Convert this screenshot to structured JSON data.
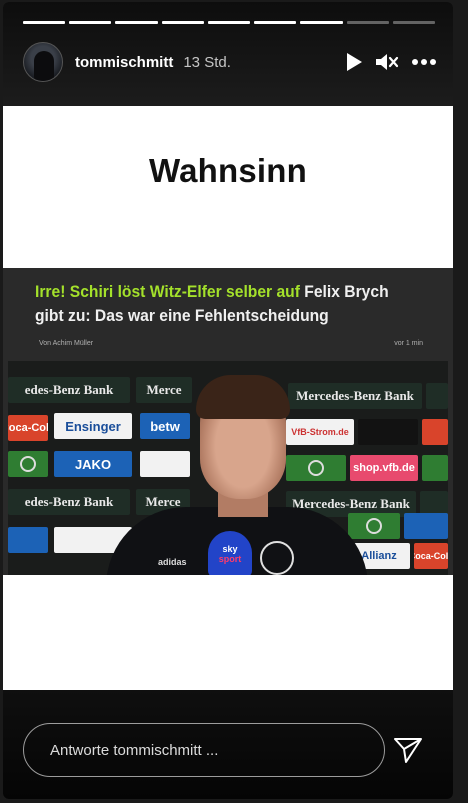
{
  "story": {
    "progress": {
      "total_segments": 9,
      "completed_segments": 7
    },
    "header": {
      "username": "tommischmitt",
      "time_ago": "13 Std.",
      "play_icon": "play-icon",
      "mute_icon": "muted-speaker-icon",
      "more_icon": "more-options-icon"
    },
    "headline": "Wahnsinn",
    "news": {
      "title_highlight": "Irre! Schiri löst Witz-Elfer selber auf",
      "title_rest": "Felix Brych gibt zu: Das war eine Fehlentscheidung",
      "author": "Von Achim Müller",
      "ago": "vor 1 min",
      "boards": {
        "mercedes": "Mercedes-Benz Bank",
        "mercedes_short": "Merce",
        "mercedes_left": "edes-Benz Bank",
        "ensinger": "Ensinger",
        "betway": "betw",
        "vfb_strom": "VfB-Strom.de",
        "jako": "JAKO",
        "shop": "shop.vfb.de",
        "allianz": "Allianz",
        "coca_cola": "Coca-Cola",
        "mic_brand": "sky",
        "mic_sub": "sport",
        "adidas": "adidas"
      }
    },
    "footer": {
      "reply_placeholder": "Antworte tommischmitt ...",
      "send_icon": "paper-plane-icon"
    }
  },
  "colors": {
    "background": "#1a1a1a",
    "story_panel": "#ffffff",
    "news_highlight": "#a4e12b",
    "text_light": "#ffffff"
  }
}
